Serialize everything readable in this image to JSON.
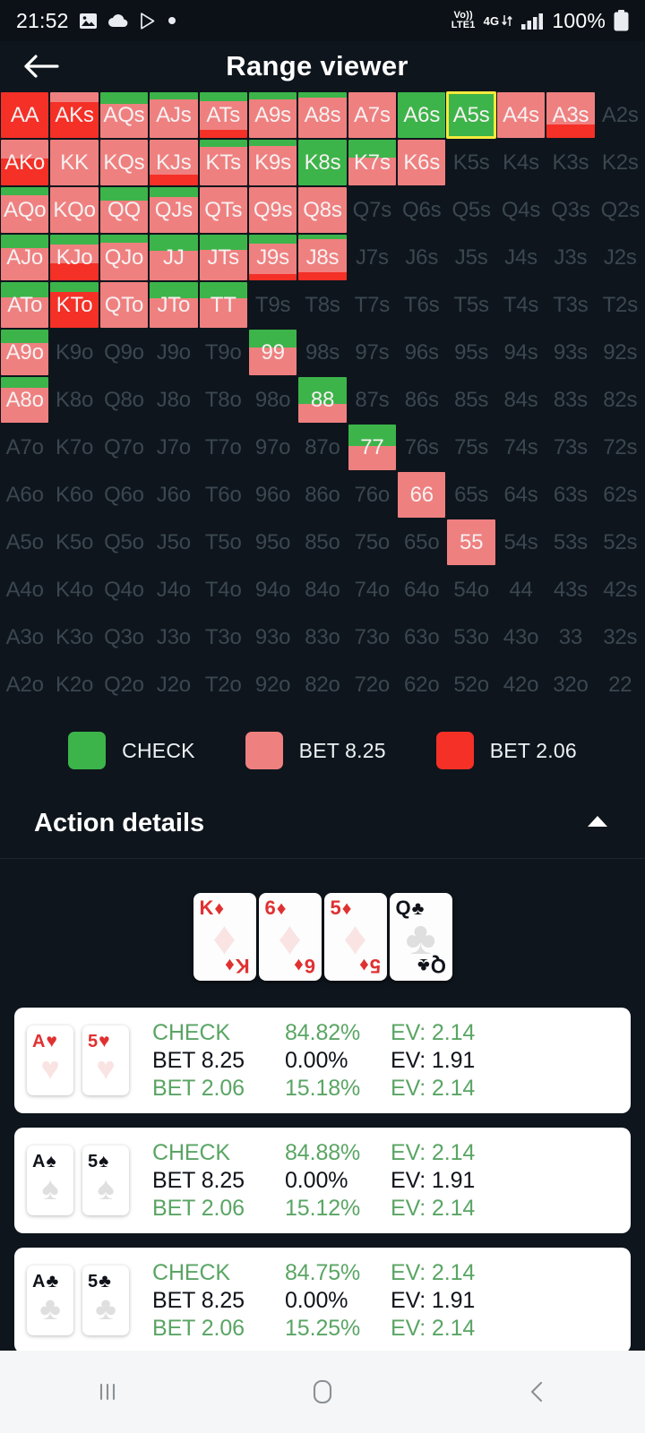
{
  "status_bar": {
    "time": "21:52",
    "left_icons": [
      "photo-icon",
      "cloud-icon",
      "play-store-icon",
      "dot-icon"
    ],
    "volte_top": "Vo))",
    "volte_bottom": "LTE1",
    "network": "4G",
    "battery_percent": "100%",
    "right_icons": [
      "volte-icon",
      "4g-data-icon",
      "signal-bars-icon",
      "battery-icon"
    ]
  },
  "header": {
    "title": "Range viewer",
    "back_icon": "back-arrow-icon"
  },
  "legend": {
    "items": [
      {
        "label": "CHECK",
        "color": "#3cb44a"
      },
      {
        "label": "BET 8.25",
        "color": "#ef8080"
      },
      {
        "label": "BET 2.06",
        "color": "#f43027"
      }
    ]
  },
  "action_details": {
    "title": "Action details",
    "caret_icon": "chevron-up-icon",
    "expanded": true
  },
  "board": {
    "cards": [
      {
        "rank": "K",
        "suit": "♦",
        "color": "red"
      },
      {
        "rank": "6",
        "suit": "♦",
        "color": "red"
      },
      {
        "rank": "5",
        "suit": "♦",
        "color": "red"
      },
      {
        "rank": "Q",
        "suit": "♣",
        "color": "black"
      }
    ]
  },
  "hand_rows": [
    {
      "cards": [
        {
          "rank": "A",
          "suit": "♥",
          "color": "red"
        },
        {
          "rank": "5",
          "suit": "♥",
          "color": "red"
        }
      ],
      "actions": [
        {
          "name": "CHECK",
          "freq": "84.82%",
          "ev": "EV: 2.14",
          "active": true
        },
        {
          "name": "BET 8.25",
          "freq": "0.00%",
          "ev": "EV: 1.91",
          "active": false
        },
        {
          "name": "BET 2.06",
          "freq": "15.18%",
          "ev": "EV: 2.14",
          "active": true
        }
      ]
    },
    {
      "cards": [
        {
          "rank": "A",
          "suit": "♠",
          "color": "black"
        },
        {
          "rank": "5",
          "suit": "♠",
          "color": "black"
        }
      ],
      "actions": [
        {
          "name": "CHECK",
          "freq": "84.88%",
          "ev": "EV: 2.14",
          "active": true
        },
        {
          "name": "BET 8.25",
          "freq": "0.00%",
          "ev": "EV: 1.91",
          "active": false
        },
        {
          "name": "BET 2.06",
          "freq": "15.12%",
          "ev": "EV: 2.14",
          "active": true
        }
      ]
    },
    {
      "cards": [
        {
          "rank": "A",
          "suit": "♣",
          "color": "black"
        },
        {
          "rank": "5",
          "suit": "♣",
          "color": "black"
        }
      ],
      "actions": [
        {
          "name": "CHECK",
          "freq": "84.75%",
          "ev": "EV: 2.14",
          "active": true
        },
        {
          "name": "BET 8.25",
          "freq": "0.00%",
          "ev": "EV: 1.91",
          "active": false
        },
        {
          "name": "BET 2.06",
          "freq": "15.25%",
          "ev": "EV: 2.14",
          "active": true
        }
      ]
    }
  ],
  "nav_bar": {
    "buttons": [
      "recents-icon",
      "home-icon",
      "back-icon"
    ]
  },
  "colors": {
    "check": "#3cb44a",
    "bet_825": "#ef8080",
    "bet_206": "#f43027",
    "selection": "#f5ea3c",
    "background": "#0e151c",
    "empty_text": "#3b4750"
  },
  "chart_data": {
    "type": "heatmap",
    "title": "Range viewer",
    "selected_cell": "A5s",
    "legend": [
      "CHECK",
      "BET 8.25",
      "BET 2.06"
    ],
    "legend_colors": [
      "#3cb44a",
      "#ef8080",
      "#f43027"
    ],
    "note": "Each cell is a vertical stacked bar: top = CHECK (green), middle = BET 8.25 (salmon), bottom = BET 2.06 (red). Values are action frequency fractions 0-1. Empty cells have no action (out of range).",
    "grid": [
      [
        {
          "l": "AA",
          "c": 0.0,
          "b8": 0.0,
          "b2": 1.0
        },
        {
          "l": "AKs",
          "c": 0.0,
          "b8": 0.22,
          "b2": 0.78
        },
        {
          "l": "AQs",
          "c": 0.26,
          "b8": 0.74,
          "b2": 0.0
        },
        {
          "l": "AJs",
          "c": 0.15,
          "b8": 0.85,
          "b2": 0.0
        },
        {
          "l": "ATs",
          "c": 0.2,
          "b8": 0.62,
          "b2": 0.18
        },
        {
          "l": "A9s",
          "c": 0.16,
          "b8": 0.84,
          "b2": 0.0
        },
        {
          "l": "A8s",
          "c": 0.12,
          "b8": 0.88,
          "b2": 0.0
        },
        {
          "l": "A7s",
          "c": 0.0,
          "b8": 1.0,
          "b2": 0.0
        },
        {
          "l": "A6s",
          "c": 1.0,
          "b8": 0.0,
          "b2": 0.0
        },
        {
          "l": "A5s",
          "c": 1.0,
          "b8": 0.0,
          "b2": 0.0
        },
        {
          "l": "A4s",
          "c": 0.0,
          "b8": 1.0,
          "b2": 0.0
        },
        {
          "l": "A3s",
          "c": 0.0,
          "b8": 0.7,
          "b2": 0.3
        },
        {
          "l": "A2s",
          "empty": true
        }
      ],
      [
        {
          "l": "AKo",
          "c": 0.0,
          "b8": 0.42,
          "b2": 0.58
        },
        {
          "l": "KK",
          "c": 0.0,
          "b8": 1.0,
          "b2": 0.0
        },
        {
          "l": "KQs",
          "c": 0.0,
          "b8": 1.0,
          "b2": 0.0
        },
        {
          "l": "KJs",
          "c": 0.0,
          "b8": 0.76,
          "b2": 0.24
        },
        {
          "l": "KTs",
          "c": 0.16,
          "b8": 0.84,
          "b2": 0.0
        },
        {
          "l": "K9s",
          "c": 0.14,
          "b8": 0.86,
          "b2": 0.0
        },
        {
          "l": "K8s",
          "c": 1.0,
          "b8": 0.0,
          "b2": 0.0
        },
        {
          "l": "K7s",
          "c": 0.4,
          "b8": 0.6,
          "b2": 0.0
        },
        {
          "l": "K6s",
          "c": 0.0,
          "b8": 1.0,
          "b2": 0.0
        },
        {
          "l": "K5s",
          "empty": true
        },
        {
          "l": "K4s",
          "empty": true
        },
        {
          "l": "K3s",
          "empty": true
        },
        {
          "l": "K2s",
          "empty": true
        }
      ],
      [
        {
          "l": "AQo",
          "c": 0.18,
          "b8": 0.82,
          "b2": 0.0
        },
        {
          "l": "KQo",
          "c": 0.0,
          "b8": 1.0,
          "b2": 0.0
        },
        {
          "l": "QQ",
          "c": 0.3,
          "b8": 0.7,
          "b2": 0.0
        },
        {
          "l": "QJs",
          "c": 0.22,
          "b8": 0.78,
          "b2": 0.0
        },
        {
          "l": "QTs",
          "c": 0.0,
          "b8": 1.0,
          "b2": 0.0
        },
        {
          "l": "Q9s",
          "c": 0.0,
          "b8": 1.0,
          "b2": 0.0
        },
        {
          "l": "Q8s",
          "c": 0.0,
          "b8": 1.0,
          "b2": 0.0
        },
        {
          "l": "Q7s",
          "empty": true
        },
        {
          "l": "Q6s",
          "empty": true
        },
        {
          "l": "Q5s",
          "empty": true
        },
        {
          "l": "Q4s",
          "empty": true
        },
        {
          "l": "Q3s",
          "empty": true
        },
        {
          "l": "Q2s",
          "empty": true
        }
      ],
      [
        {
          "l": "AJo",
          "c": 0.3,
          "b8": 0.7,
          "b2": 0.0
        },
        {
          "l": "KJo",
          "c": 0.22,
          "b8": 0.4,
          "b2": 0.38
        },
        {
          "l": "QJo",
          "c": 0.18,
          "b8": 0.82,
          "b2": 0.0
        },
        {
          "l": "JJ",
          "c": 0.36,
          "b8": 0.64,
          "b2": 0.0
        },
        {
          "l": "JTs",
          "c": 0.34,
          "b8": 0.66,
          "b2": 0.0
        },
        {
          "l": "J9s",
          "c": 0.2,
          "b8": 0.66,
          "b2": 0.14
        },
        {
          "l": "J8s",
          "c": 0.1,
          "b8": 0.72,
          "b2": 0.18
        },
        {
          "l": "J7s",
          "empty": true
        },
        {
          "l": "J6s",
          "empty": true
        },
        {
          "l": "J5s",
          "empty": true
        },
        {
          "l": "J4s",
          "empty": true
        },
        {
          "l": "J3s",
          "empty": true
        },
        {
          "l": "J2s",
          "empty": true
        }
      ],
      [
        {
          "l": "ATo",
          "c": 0.34,
          "b8": 0.66,
          "b2": 0.0
        },
        {
          "l": "KTo",
          "c": 0.22,
          "b8": 0.0,
          "b2": 0.78
        },
        {
          "l": "QTo",
          "c": 0.0,
          "b8": 1.0,
          "b2": 0.0
        },
        {
          "l": "JTo",
          "c": 0.36,
          "b8": 0.64,
          "b2": 0.0
        },
        {
          "l": "TT",
          "c": 0.36,
          "b8": 0.64,
          "b2": 0.0
        },
        {
          "l": "T9s",
          "empty": true
        },
        {
          "l": "T8s",
          "empty": true
        },
        {
          "l": "T7s",
          "empty": true
        },
        {
          "l": "T6s",
          "empty": true
        },
        {
          "l": "T5s",
          "empty": true
        },
        {
          "l": "T4s",
          "empty": true
        },
        {
          "l": "T3s",
          "empty": true
        },
        {
          "l": "T2s",
          "empty": true
        }
      ],
      [
        {
          "l": "A9o",
          "c": 0.3,
          "b8": 0.7,
          "b2": 0.0
        },
        {
          "l": "K9o",
          "empty": true
        },
        {
          "l": "Q9o",
          "empty": true
        },
        {
          "l": "J9o",
          "empty": true
        },
        {
          "l": "T9o",
          "empty": true
        },
        {
          "l": "99",
          "c": 0.4,
          "b8": 0.6,
          "b2": 0.0
        },
        {
          "l": "98s",
          "empty": true
        },
        {
          "l": "97s",
          "empty": true
        },
        {
          "l": "96s",
          "empty": true
        },
        {
          "l": "95s",
          "empty": true
        },
        {
          "l": "94s",
          "empty": true
        },
        {
          "l": "93s",
          "empty": true
        },
        {
          "l": "92s",
          "empty": true
        }
      ],
      [
        {
          "l": "A8o",
          "c": 0.24,
          "b8": 0.76,
          "b2": 0.0
        },
        {
          "l": "K8o",
          "empty": true
        },
        {
          "l": "Q8o",
          "empty": true
        },
        {
          "l": "J8o",
          "empty": true
        },
        {
          "l": "T8o",
          "empty": true
        },
        {
          "l": "98o",
          "empty": true
        },
        {
          "l": "88",
          "c": 0.58,
          "b8": 0.42,
          "b2": 0.0
        },
        {
          "l": "87s",
          "empty": true
        },
        {
          "l": "86s",
          "empty": true
        },
        {
          "l": "85s",
          "empty": true
        },
        {
          "l": "84s",
          "empty": true
        },
        {
          "l": "83s",
          "empty": true
        },
        {
          "l": "82s",
          "empty": true
        }
      ],
      [
        {
          "l": "A7o",
          "empty": true
        },
        {
          "l": "K7o",
          "empty": true
        },
        {
          "l": "Q7o",
          "empty": true
        },
        {
          "l": "J7o",
          "empty": true
        },
        {
          "l": "T7o",
          "empty": true
        },
        {
          "l": "97o",
          "empty": true
        },
        {
          "l": "87o",
          "empty": true
        },
        {
          "l": "77",
          "c": 0.48,
          "b8": 0.52,
          "b2": 0.0
        },
        {
          "l": "76s",
          "empty": true
        },
        {
          "l": "75s",
          "empty": true
        },
        {
          "l": "74s",
          "empty": true
        },
        {
          "l": "73s",
          "empty": true
        },
        {
          "l": "72s",
          "empty": true
        }
      ],
      [
        {
          "l": "A6o",
          "empty": true
        },
        {
          "l": "K6o",
          "empty": true
        },
        {
          "l": "Q6o",
          "empty": true
        },
        {
          "l": "J6o",
          "empty": true
        },
        {
          "l": "T6o",
          "empty": true
        },
        {
          "l": "96o",
          "empty": true
        },
        {
          "l": "86o",
          "empty": true
        },
        {
          "l": "76o",
          "empty": true
        },
        {
          "l": "66",
          "c": 0.0,
          "b8": 1.0,
          "b2": 0.0
        },
        {
          "l": "65s",
          "empty": true
        },
        {
          "l": "64s",
          "empty": true
        },
        {
          "l": "63s",
          "empty": true
        },
        {
          "l": "62s",
          "empty": true
        }
      ],
      [
        {
          "l": "A5o",
          "empty": true
        },
        {
          "l": "K5o",
          "empty": true
        },
        {
          "l": "Q5o",
          "empty": true
        },
        {
          "l": "J5o",
          "empty": true
        },
        {
          "l": "T5o",
          "empty": true
        },
        {
          "l": "95o",
          "empty": true
        },
        {
          "l": "85o",
          "empty": true
        },
        {
          "l": "75o",
          "empty": true
        },
        {
          "l": "65o",
          "empty": true
        },
        {
          "l": "55",
          "c": 0.0,
          "b8": 1.0,
          "b2": 0.0
        },
        {
          "l": "54s",
          "empty": true
        },
        {
          "l": "53s",
          "empty": true
        },
        {
          "l": "52s",
          "empty": true
        }
      ],
      [
        {
          "l": "A4o",
          "empty": true
        },
        {
          "l": "K4o",
          "empty": true
        },
        {
          "l": "Q4o",
          "empty": true
        },
        {
          "l": "J4o",
          "empty": true
        },
        {
          "l": "T4o",
          "empty": true
        },
        {
          "l": "94o",
          "empty": true
        },
        {
          "l": "84o",
          "empty": true
        },
        {
          "l": "74o",
          "empty": true
        },
        {
          "l": "64o",
          "empty": true
        },
        {
          "l": "54o",
          "empty": true
        },
        {
          "l": "44",
          "empty": true
        },
        {
          "l": "43s",
          "empty": true
        },
        {
          "l": "42s",
          "empty": true
        }
      ],
      [
        {
          "l": "A3o",
          "empty": true
        },
        {
          "l": "K3o",
          "empty": true
        },
        {
          "l": "Q3o",
          "empty": true
        },
        {
          "l": "J3o",
          "empty": true
        },
        {
          "l": "T3o",
          "empty": true
        },
        {
          "l": "93o",
          "empty": true
        },
        {
          "l": "83o",
          "empty": true
        },
        {
          "l": "73o",
          "empty": true
        },
        {
          "l": "63o",
          "empty": true
        },
        {
          "l": "53o",
          "empty": true
        },
        {
          "l": "43o",
          "empty": true
        },
        {
          "l": "33",
          "empty": true
        },
        {
          "l": "32s",
          "empty": true
        }
      ],
      [
        {
          "l": "A2o",
          "empty": true
        },
        {
          "l": "K2o",
          "empty": true
        },
        {
          "l": "Q2o",
          "empty": true
        },
        {
          "l": "J2o",
          "empty": true
        },
        {
          "l": "T2o",
          "empty": true
        },
        {
          "l": "92o",
          "empty": true
        },
        {
          "l": "82o",
          "empty": true
        },
        {
          "l": "72o",
          "empty": true
        },
        {
          "l": "62o",
          "empty": true
        },
        {
          "l": "52o",
          "empty": true
        },
        {
          "l": "42o",
          "empty": true
        },
        {
          "l": "32o",
          "empty": true
        },
        {
          "l": "22",
          "empty": true
        }
      ]
    ]
  }
}
